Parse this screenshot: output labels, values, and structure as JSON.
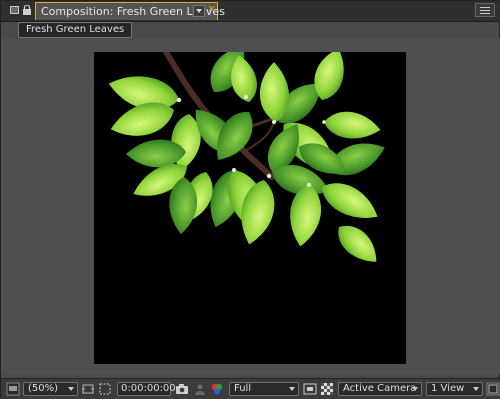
{
  "panel": {
    "tab_title": "Composition: Fresh Green Leaves",
    "close_glyph": "×",
    "comp_chip": "Fresh Green Leaves"
  },
  "bottom_bar": {
    "magnification": "(50%)",
    "timecode": "0:00:00:00",
    "resolution": "Full",
    "camera": "Active Camera",
    "views": "1 View"
  },
  "colors": {
    "accent": "#e3a92b",
    "canvas_bg": "#000000",
    "leaf_light": "#c8f06a",
    "leaf_mid": "#7cc532",
    "leaf_dark": "#2e6b1c",
    "branch": "#4a2e24"
  },
  "icons": [
    "lock-icon",
    "panel-icon",
    "dropdown-icon",
    "close-icon",
    "panel-menu-icon",
    "monitor-icon",
    "region-of-interest-icon",
    "transparency-grid-icon",
    "camera-icon",
    "color-channels-icon",
    "render-icon",
    "fast-preview-icon",
    "expand-icon"
  ]
}
